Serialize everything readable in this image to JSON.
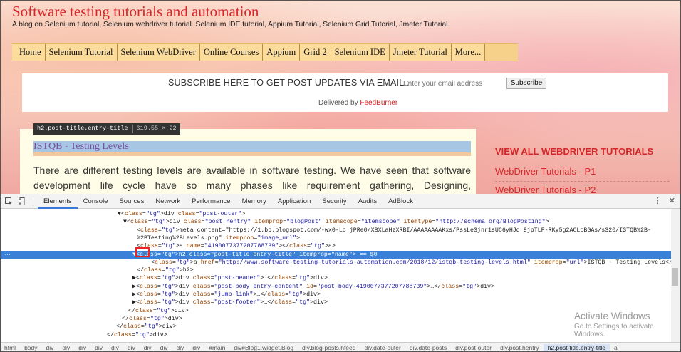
{
  "blog": {
    "title": "Software testing tutorials and automation",
    "description": "A blog on Selenium tutorial, Selenium webdriver tutorial. Selenium IDE tutorial, Appium Tutorial, Selenium Grid Tutorial, Jmeter Tutorial."
  },
  "nav": {
    "items": [
      {
        "label": "Home"
      },
      {
        "label": "Selenium Tutorial"
      },
      {
        "label": "Selenium WebDriver"
      },
      {
        "label": "Online Courses"
      },
      {
        "label": "Appium"
      },
      {
        "label": "Grid 2"
      },
      {
        "label": "Selenium IDE"
      },
      {
        "label": "Jmeter Tutorial"
      },
      {
        "label": "More..."
      }
    ]
  },
  "subscribe": {
    "label": "SUBSCRIBE HERE TO GET POST UPDATES VIA EMAIL :",
    "placeholder": "Enter your email address",
    "button": "Subscribe",
    "delivered_prefix": "Delivered by",
    "delivered_brand": "FeedBurner"
  },
  "tooltip": {
    "selector": "h2.post-title.entry-title",
    "size": "619.55 × 22"
  },
  "post": {
    "title": "ISTQB - Testing Levels",
    "body": "There are different testing levels are available in software testing. We have seen that software development life cycle have so many phases like requirement gathering, Designing,"
  },
  "sidebar": {
    "heading": "VIEW ALL WEBDRIVER TUTORIALS",
    "link1": "WebDriver Tutorials - P1",
    "link2": "WebDriver Tutorials - P2"
  },
  "devtools": {
    "tabs": [
      "Elements",
      "Console",
      "Sources",
      "Network",
      "Performance",
      "Memory",
      "Application",
      "Security",
      "Audits",
      "AdBlock"
    ],
    "active_tab": "Elements",
    "code_lines": [
      {
        "indent": 165,
        "text": "▼<div class=\"post-outer\">"
      },
      {
        "indent": 173,
        "text": "▼<div class=\"post hentry\" itemprop=\"blogPost\" itemscope=\"itemscope\" itemtype=\"http://schema.org/BlogPosting\">"
      },
      {
        "indent": 192,
        "text": "<meta content=\"https://1.bp.blogspot.com/-wx0-Lc jPRe0/XBXLaHzXRBI/AAAAAAAAKxs/PssLe3jnr1sUC6yHJq_9jpTLF-RKy5g2ACLcBGAs/s320/ISTQB%2B-"
      },
      {
        "indent": 192,
        "text": "%2BTesting%2BLevels.png\" itemprop=\"image_url\">"
      },
      {
        "indent": 192,
        "text": "<a name=\"4190077377207788739\"></a>"
      },
      {
        "indent": 186,
        "text": "▼<h2 class=\"post-title entry-title\" itemprop=\"name\"> == $0",
        "selected": true
      },
      {
        "indent": 212,
        "text": "<a href=\"http://www.software-testing-tutorials-automation.com/2018/12/istqb-testing-levels.html\" itemprop=\"url\">ISTQB - Testing Levels</a>"
      },
      {
        "indent": 192,
        "text": "</h2>"
      },
      {
        "indent": 186,
        "text": "▶<div class=\"post-header\">…</div>"
      },
      {
        "indent": 186,
        "text": "▶<div class=\"post-body entry-content\" id=\"post-body-4190077377207788739\">…</div>"
      },
      {
        "indent": 186,
        "text": "▶<div class=\"jump-link\">…</div>"
      },
      {
        "indent": 186,
        "text": "▶<div class=\"post-footer\">…</div>"
      },
      {
        "indent": 180,
        "text": "</div>"
      },
      {
        "indent": 171,
        "text": "</div>"
      },
      {
        "indent": 163,
        "text": "</div>"
      },
      {
        "indent": 150,
        "text": "</div>"
      }
    ],
    "breadcrumb": [
      "html",
      "body",
      "div",
      "div",
      "div",
      "div",
      "div",
      "div",
      "div",
      "div",
      "div",
      "div",
      "#main",
      "div#Blog1.widget.Blog",
      "div.blog-posts.hfeed",
      "div.date-outer",
      "div.date-posts",
      "div.post-outer",
      "div.post.hentry",
      "h2.post-title.entry-title",
      "a"
    ],
    "breadcrumb_active": "h2.post-title.entry-title"
  },
  "watermark": {
    "title": "Activate Windows",
    "subtitle": "Go to Settings to activate Windows."
  }
}
